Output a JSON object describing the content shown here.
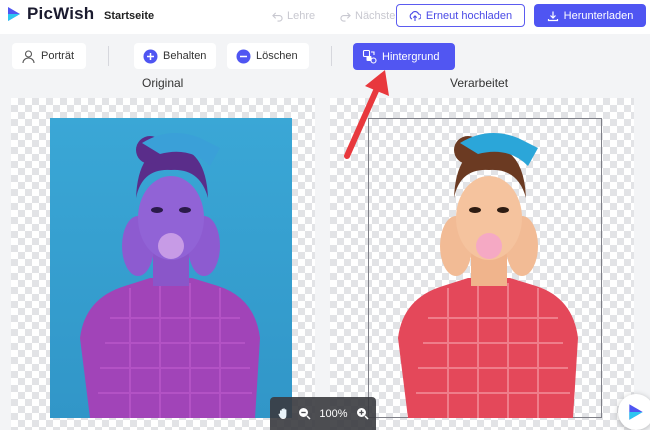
{
  "header": {
    "app_name": "PicWish",
    "nav_home": "Startseite",
    "undo_label": "Lehre",
    "redo_label": "Nächste",
    "reupload_label": "Erneut hochladen",
    "download_label": "Herunterladen"
  },
  "toolbar": {
    "portrait_label": "Porträt",
    "keep_label": "Behalten",
    "delete_label": "Löschen",
    "background_label": "Hintergrund"
  },
  "panels": {
    "original_label": "Original",
    "processed_label": "Verarbeitet"
  },
  "zoom": {
    "value": "100%"
  },
  "colors": {
    "accent": "#4f55f2",
    "arrow": "#e8383d",
    "original_bg": "#3aa7d6"
  },
  "icons": {
    "logo": "picwish-logo-icon",
    "undo": "undo-icon",
    "redo": "redo-icon",
    "upload": "upload-icon",
    "download": "download-icon",
    "portrait": "person-icon",
    "keep": "plus-circle-icon",
    "delete": "minus-circle-icon",
    "background": "background-swap-icon",
    "hand": "hand-icon",
    "zoom_out": "zoom-out-icon",
    "zoom_in": "zoom-in-icon"
  }
}
